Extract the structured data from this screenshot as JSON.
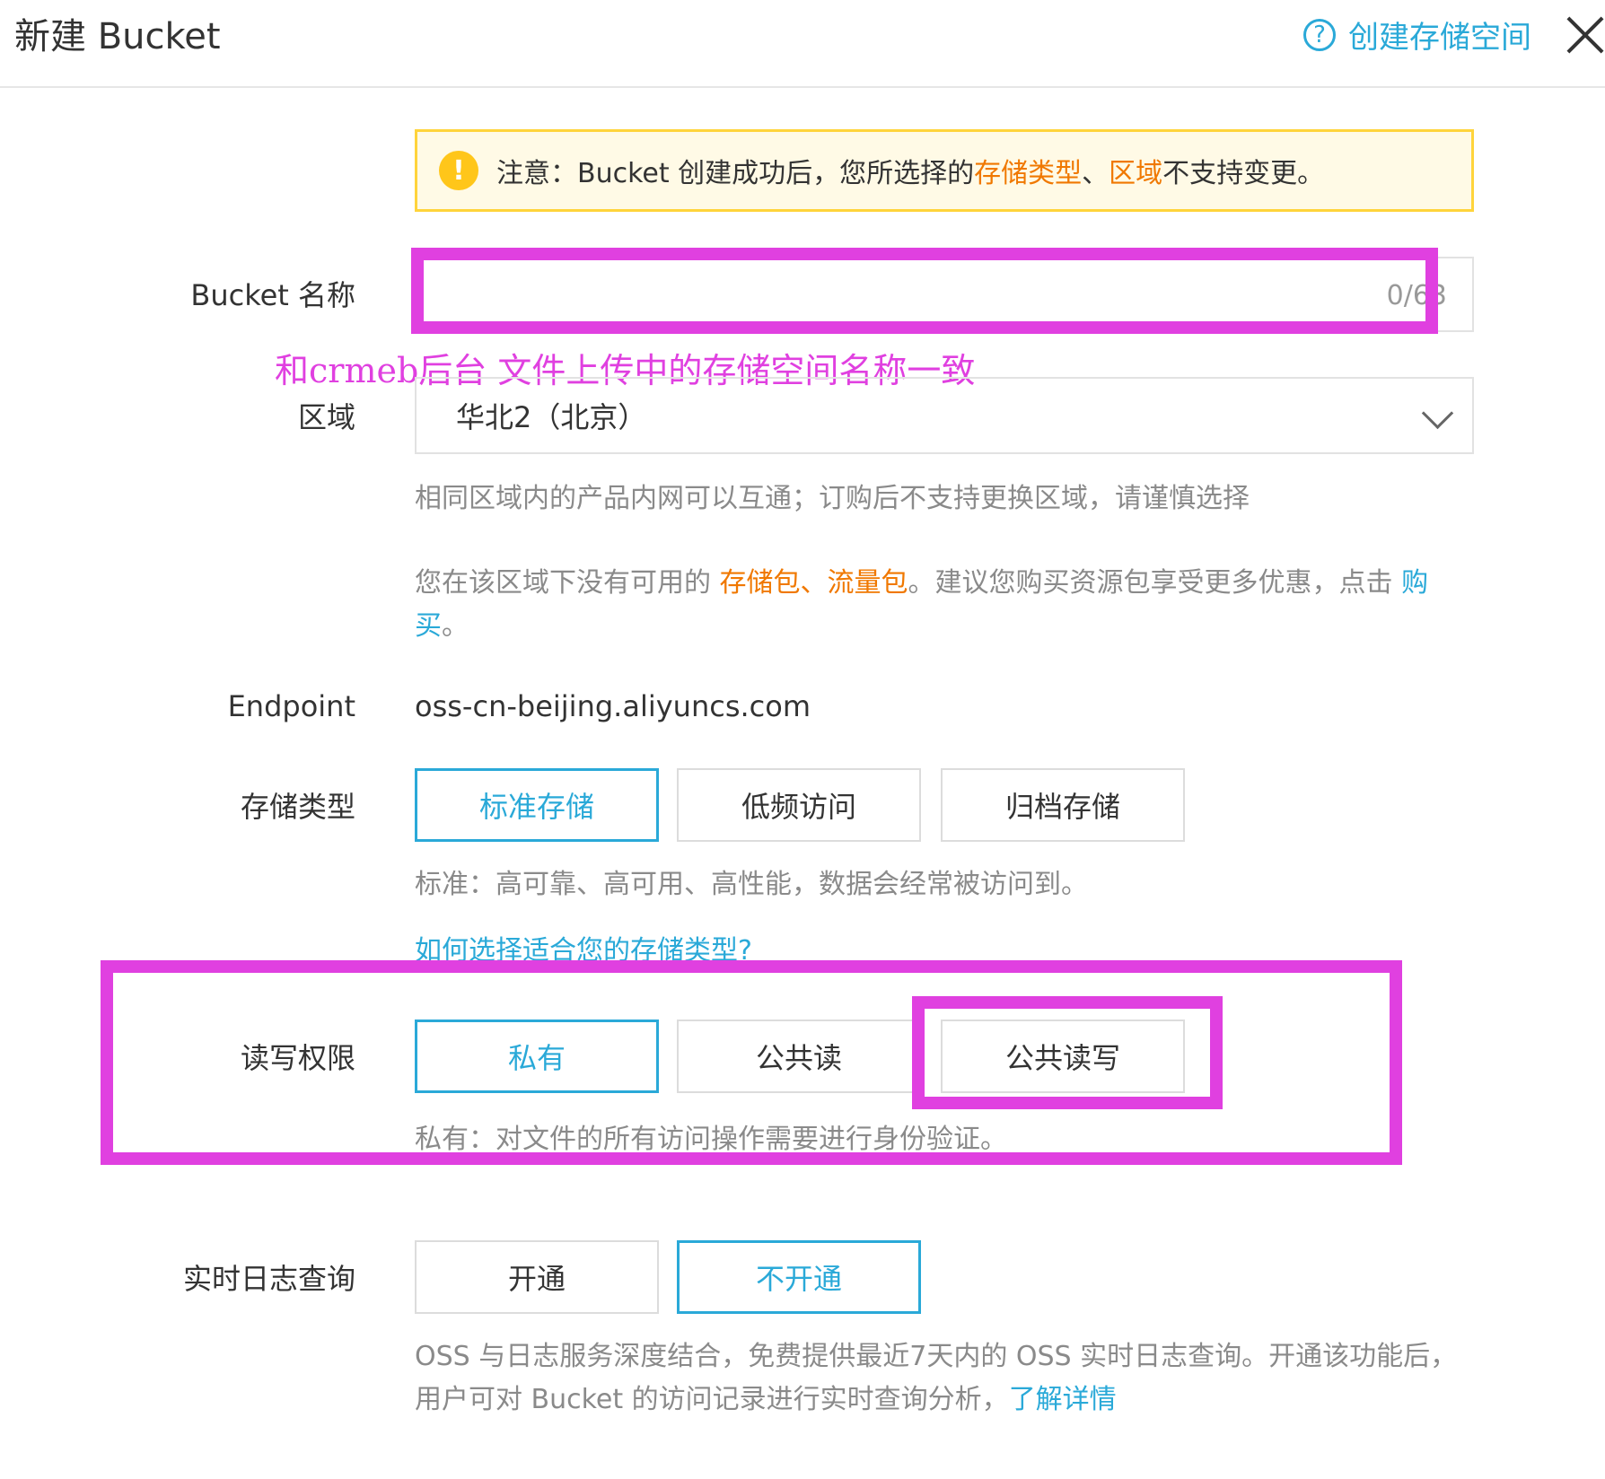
{
  "header": {
    "title": "新建 Bucket",
    "help_icon": "?",
    "help_link": "创建存储空间",
    "close_icon": "close-icon"
  },
  "notice": {
    "icon": "!",
    "prefix": "注意：Bucket 创建成功后，您所选择的",
    "storage_type": "存储类型",
    "sep": "、",
    "region": "区域",
    "suffix": "不支持变更。"
  },
  "bucket_name": {
    "label": "Bucket 名称",
    "value": "",
    "counter": "0/63",
    "annotation": "和crmeb后台 文件上传中的存储空间名称一致"
  },
  "region": {
    "label": "区域",
    "value": "华北2（北京）",
    "hint": "相同区域内的产品内网可以互通；订购后不支持更换区域，请谨慎选择",
    "pkg_prefix": "您在该区域下没有可用的 ",
    "pkg_storage": "存储包",
    "pkg_sep": "、",
    "pkg_traffic": "流量包",
    "pkg_middle": "。建议您购买资源包享受更多优惠，点击 ",
    "pkg_buy": "购买",
    "pkg_end": "。"
  },
  "endpoint": {
    "label": "Endpoint",
    "value": "oss-cn-beijing.aliyuncs.com"
  },
  "storage_class": {
    "label": "存储类型",
    "options": [
      "标准存储",
      "低频访问",
      "归档存储"
    ],
    "selected": "标准存储",
    "hint": "标准：高可靠、高可用、高性能，数据会经常被访问到。",
    "link": "如何选择适合您的存储类型?"
  },
  "acl": {
    "label": "读写权限",
    "options": [
      "私有",
      "公共读",
      "公共读写"
    ],
    "selected": "私有",
    "hint": "私有：对文件的所有访问操作需要进行身份验证。"
  },
  "realtime_log": {
    "label": "实时日志查询",
    "options": [
      "开通",
      "不开通"
    ],
    "selected": "不开通",
    "hint": "OSS 与日志服务深度结合，免费提供最近7天内的 OSS 实时日志查询。开通该功能后，用户可对 Bucket 的访问记录进行实时查询分析，",
    "link": "了解详情"
  },
  "colors": {
    "accent": "#2aa9d8",
    "warning": "#f07800",
    "annotation": "#e040e0",
    "notice_border": "#ffd43b"
  }
}
